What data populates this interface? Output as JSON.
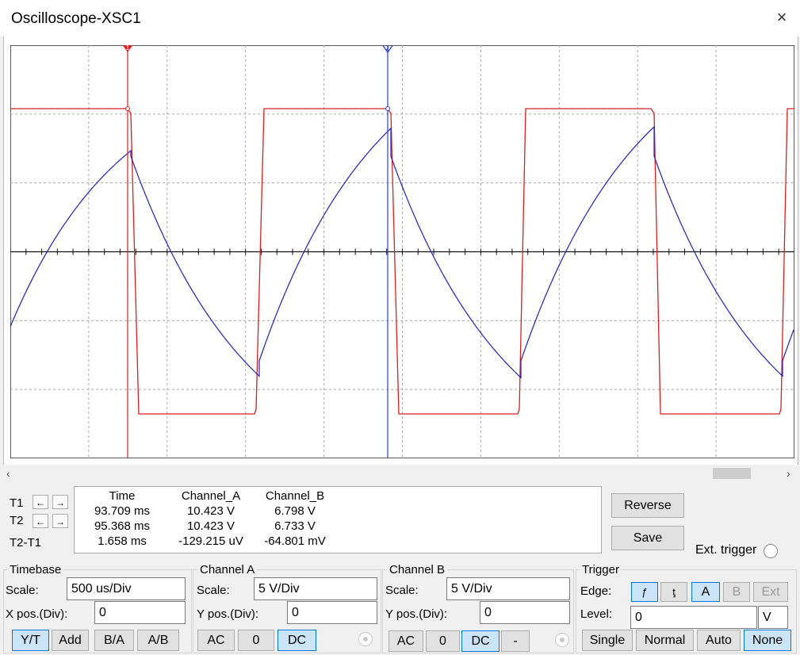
{
  "window": {
    "title": "Oscilloscope-XSC1",
    "close_icon": "×"
  },
  "colors": {
    "channel_a": "#d42020",
    "channel_b": "#2020c0",
    "cursor_t1": "#d42020",
    "cursor_t2": "#2a3fd0",
    "grid": "#a8a8a8",
    "selected": "#cce4f7"
  },
  "cursors": {
    "t1_label": "T1",
    "t2_label": "T2",
    "diff_label": "T2-T1",
    "left_arrow": "←",
    "right_arrow": "→",
    "t1_marker": "1",
    "t2_marker": "2"
  },
  "readout": {
    "headers": [
      "Time",
      "Channel_A",
      "Channel_B"
    ],
    "rows": [
      [
        "93.709 ms",
        "10.423 V",
        "6.798 V"
      ],
      [
        "95.368 ms",
        "10.423 V",
        "6.733 V"
      ],
      [
        "1.658 ms",
        "-129.215 uV",
        "-64.801 mV"
      ]
    ]
  },
  "buttons": {
    "reverse": "Reverse",
    "save": "Save"
  },
  "ext_trigger": {
    "label": "Ext. trigger"
  },
  "timebase": {
    "title": "Timebase",
    "scale_label": "Scale:",
    "scale_value": "500 us/Div",
    "xpos_label": "X pos.(Div):",
    "xpos_value": "0",
    "modes": [
      "Y/T",
      "Add",
      "B/A",
      "A/B"
    ],
    "selected_mode": "Y/T"
  },
  "channel_a": {
    "title": "Channel A",
    "scale_label": "Scale:",
    "scale_value": "5  V/Div",
    "ypos_label": "Y pos.(Div):",
    "ypos_value": "0",
    "coupling": [
      "AC",
      "0",
      "DC"
    ],
    "selected_coupling": "DC"
  },
  "channel_b": {
    "title": "Channel B",
    "scale_label": "Scale:",
    "scale_value": "5  V/Div",
    "ypos_label": "Y pos.(Div):",
    "ypos_value": "0",
    "coupling": [
      "AC",
      "0",
      "DC",
      "-"
    ],
    "selected_coupling": "DC"
  },
  "trigger": {
    "title": "Trigger",
    "edge_label": "Edge:",
    "edge_icons": [
      "rising-edge-icon",
      "falling-edge-icon"
    ],
    "edge_glyphs": [
      "ƒ",
      "ƫ"
    ],
    "sources": [
      "A",
      "B",
      "Ext"
    ],
    "selected_source": "A",
    "level_label": "Level:",
    "level_value": "0",
    "level_unit": "V",
    "modes": [
      "Single",
      "Normal",
      "Auto",
      "None"
    ],
    "selected_mode": "None"
  }
}
